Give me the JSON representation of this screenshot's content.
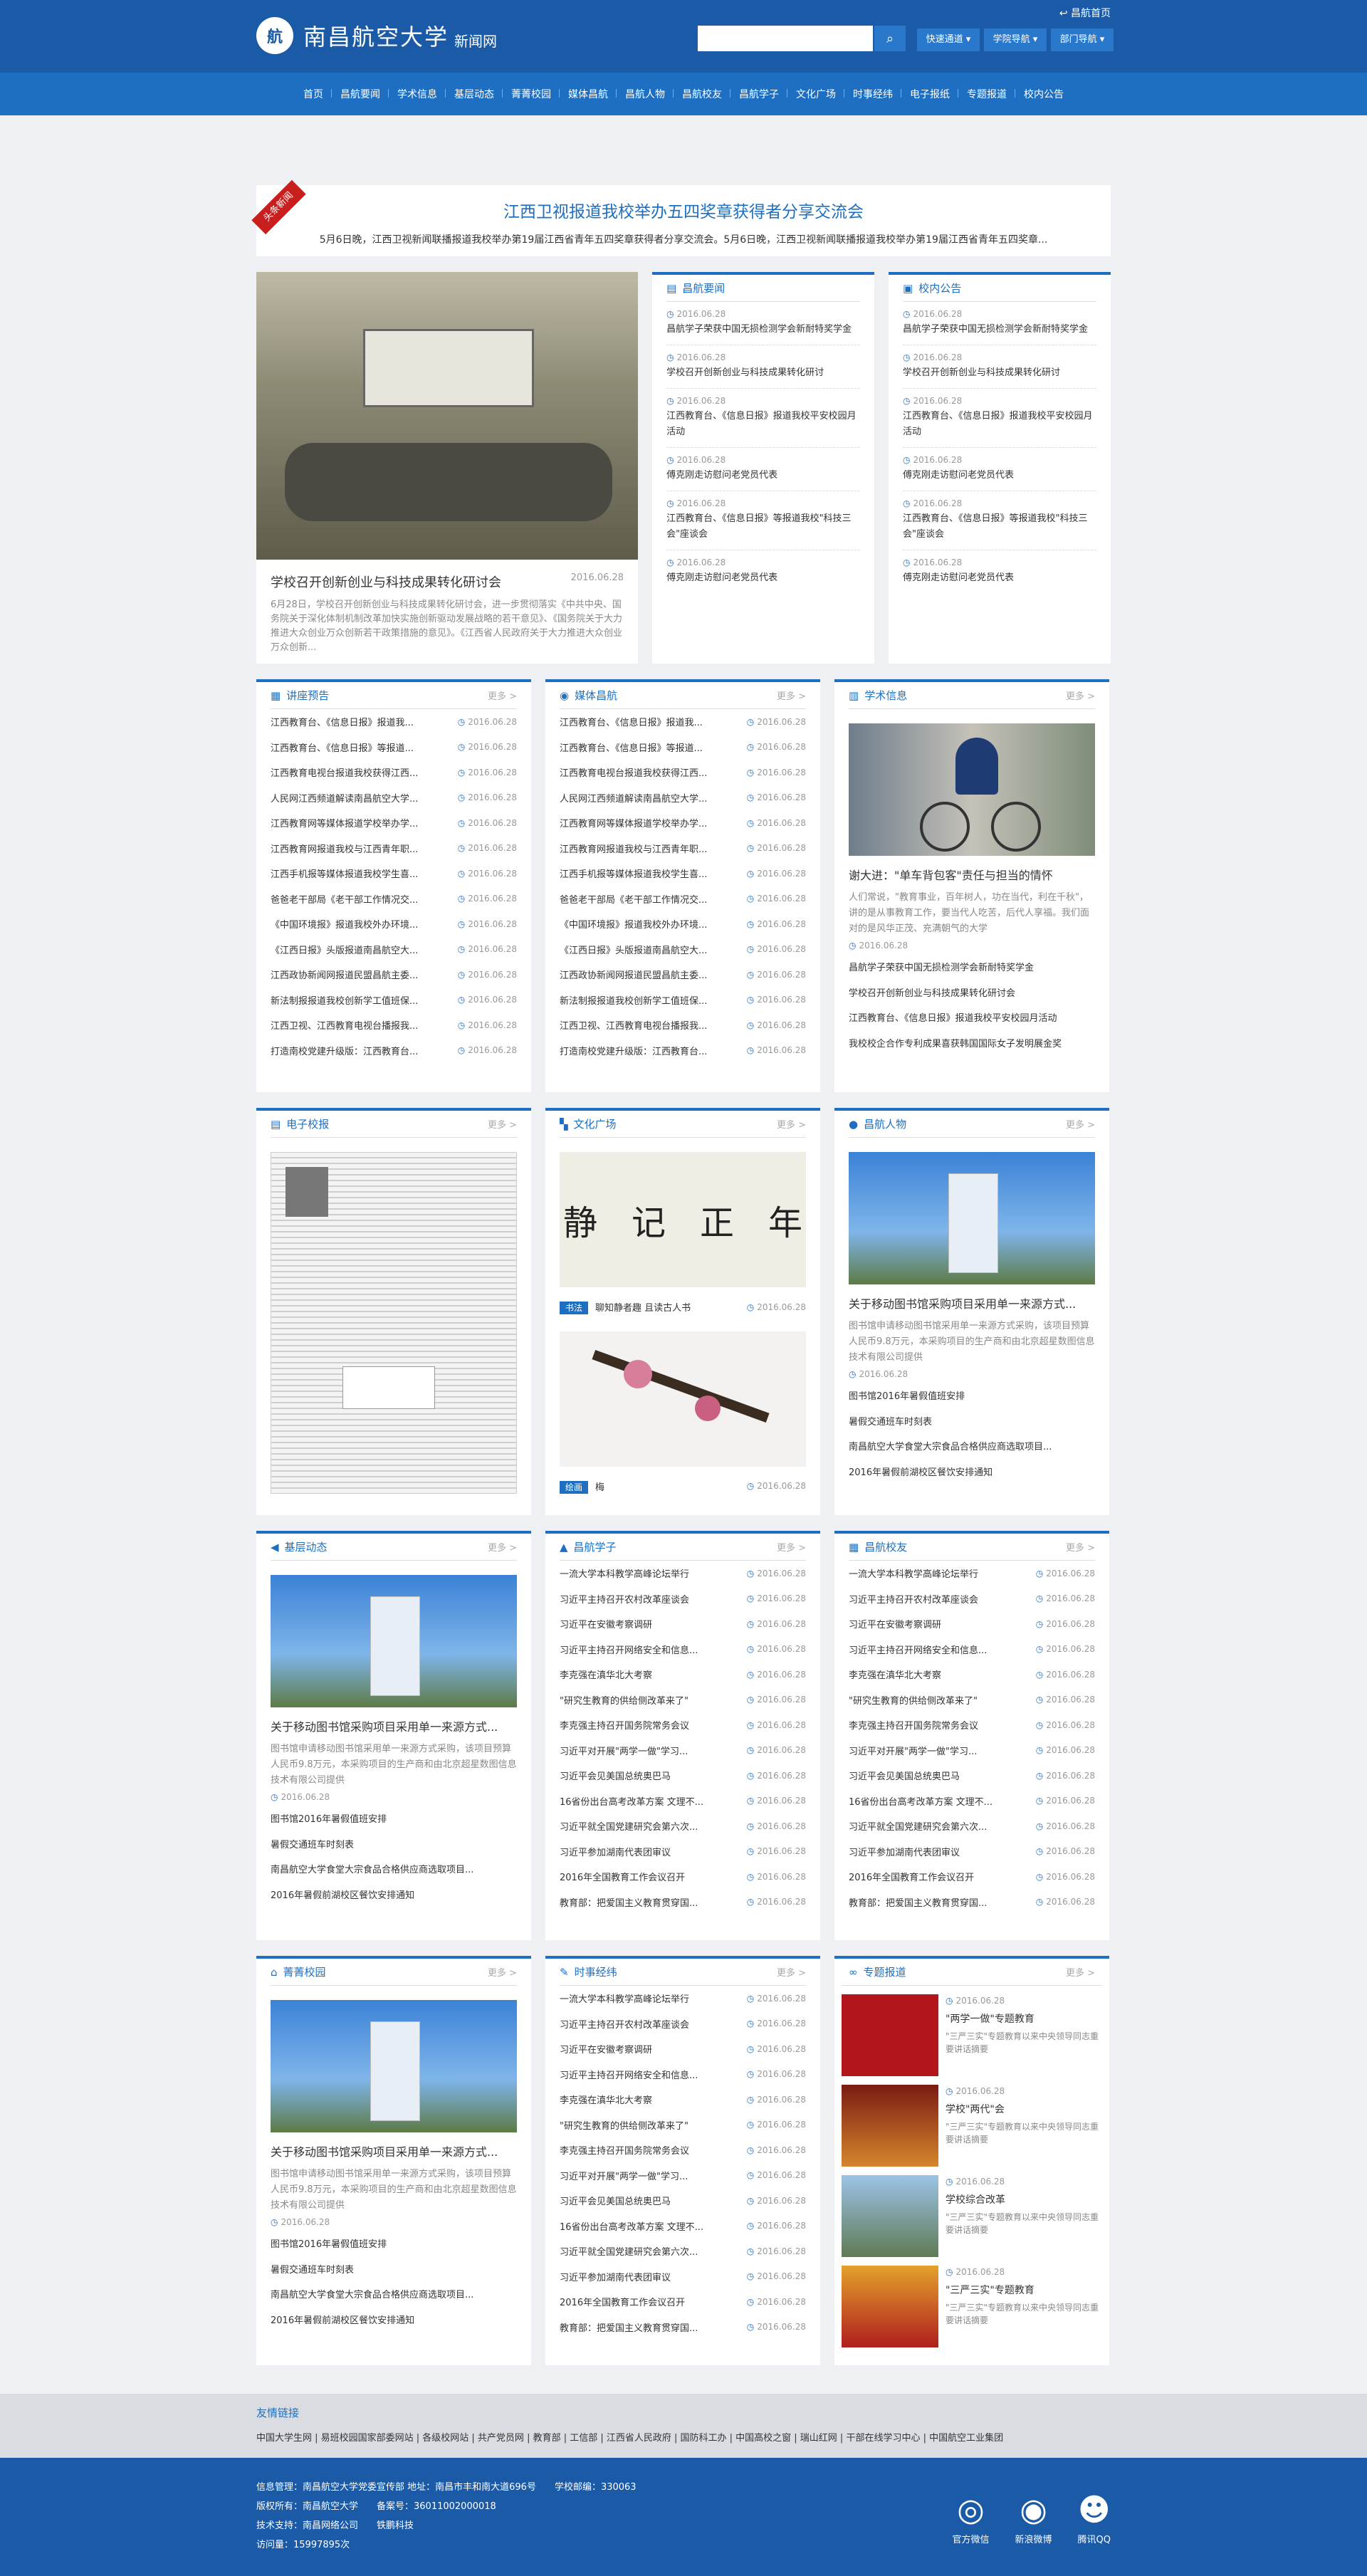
{
  "header": {
    "logo_text": "南昌航空大学",
    "logo_sub": "新闻网",
    "home_link": "昌航首页",
    "quick": [
      "快速通道",
      "学院导航",
      "部门导航"
    ]
  },
  "nav": [
    "首页",
    "昌航要闻",
    "学术信息",
    "基层动态",
    "菁菁校园",
    "媒体昌航",
    "昌航人物",
    "昌航校友",
    "昌航学子",
    "文化广场",
    "时事经纬",
    "电子报纸",
    "专题报道",
    "校内公告"
  ],
  "headline": {
    "tag": "头条新闻",
    "title": "江西卫视报道我校举办五四奖章获得者分享交流会",
    "summary": "5月6日晚，江西卫视新闻联播报道我校举办第19届江西省青年五四奖章获得者分享交流会。5月6日晚，江西卫视新闻联播报道我校举办第19届江西省青年五四奖章..."
  },
  "feature": {
    "title": "学校召开创新创业与科技成果转化研讨会",
    "date": "2016.06.28",
    "desc": "6月28日，学校召开创新创业与科技成果转化研讨会，进一步贯彻落实《中共中央、国务院关于深化体制机制改革加快实施创新驱动发展战略的若干意见》、《国务院关于大力推进大众创业万众创新若干政策措施的意见》。《江西省人民政府关于大力推进大众创业万众创新..."
  },
  "news": {
    "title": "昌航要闻",
    "items": [
      {
        "d": "2016.06.28",
        "t": "昌航学子荣获中国无损检测学会新耐特奖学金"
      },
      {
        "d": "2016.06.28",
        "t": "学校召开创新创业与科技成果转化研讨"
      },
      {
        "d": "2016.06.28",
        "t": "江西教育台、《信息日报》报道我校平安校园月活动"
      },
      {
        "d": "2016.06.28",
        "t": "傅克刚走访慰问老党员代表"
      },
      {
        "d": "2016.06.28",
        "t": "江西教育台、《信息日报》等报道我校\"科技三会\"座谈会"
      },
      {
        "d": "2016.06.28",
        "t": "傅克刚走访慰问老党员代表"
      }
    ]
  },
  "notice": {
    "title": "校内公告",
    "items": [
      {
        "d": "2016.06.28",
        "t": "昌航学子荣获中国无损检测学会新耐特奖学金"
      },
      {
        "d": "2016.06.28",
        "t": "学校召开创新创业与科技成果转化研讨"
      },
      {
        "d": "2016.06.28",
        "t": "江西教育台、《信息日报》报道我校平安校园月活动"
      },
      {
        "d": "2016.06.28",
        "t": "傅克刚走访慰问老党员代表"
      },
      {
        "d": "2016.06.28",
        "t": "江西教育台、《信息日报》等报道我校\"科技三会\"座谈会"
      },
      {
        "d": "2016.06.28",
        "t": "傅克刚走访慰问老党员代表"
      }
    ]
  },
  "more": "更多 >",
  "lecture": {
    "title": "讲座预告",
    "items": [
      "江西教育台、《信息日报》报道我...",
      "江西教育台、《信息日报》等报道...",
      "江西教育电视台报道我校获得江西...",
      "人民网江西频道解读南昌航空大学...",
      "江西教育网等媒体报道学校举办学...",
      "江西教育网报道我校与江西青年职...",
      "江西手机报等媒体报道我校学生喜...",
      "爸爸老干部局《老干部工作情况交...",
      "《中国环境报》报道我校外办环境...",
      "《江西日报》头版报道南昌航空大...",
      "江西政协新闻网报道民盟昌航主委...",
      "新法制报报道我校创新学工值班保...",
      "江西卫视、江西教育电视台播报我...",
      "打造南校党建升级版：江西教育台..."
    ]
  },
  "media": {
    "title": "媒体昌航",
    "items": [
      "江西教育台、《信息日报》报道我...",
      "江西教育台、《信息日报》等报道...",
      "江西教育电视台报道我校获得江西...",
      "人民网江西频道解读南昌航空大学...",
      "江西教育网等媒体报道学校举办学...",
      "江西教育网报道我校与江西青年职...",
      "江西手机报等媒体报道我校学生喜...",
      "爸爸老干部局《老干部工作情况交...",
      "《中国环境报》报道我校外办环境...",
      "《江西日报》头版报道南昌航空大...",
      "江西政协新闻网报道民盟昌航主委...",
      "新法制报报道我校创新学工值班保...",
      "江西卫视、江西教育电视台播报我...",
      "打造南校党建升级版：江西教育台..."
    ]
  },
  "academic": {
    "title": "学术信息",
    "cap": "谢大进：\"单车背包客\"责任与担当的情怀",
    "desc": "人们常说，\"教育事业，百年树人，功在当代，利在千秋\"，讲的是从事教育工作，要当代人吃苦，后代人享福。我们面对的是风华正茂、充满朝气的大学",
    "date": "2016.06.28",
    "links": [
      "昌航学子荣获中国无损检测学会新耐特奖学金",
      "学校召开创新创业与科技成果转化研讨会",
      "江西教育台、《信息日报》报道我校平安校园月活动",
      "我校校企合作专利成果喜获韩国国际女子发明展金奖"
    ]
  },
  "epaper": {
    "title": "电子校报"
  },
  "culture": {
    "title": "文化广场",
    "i1tag": "书法",
    "i1": "聊知静者趣 且读古人书",
    "i2tag": "绘画",
    "i2": "梅",
    "date": "2016.06.28",
    "calli": "静　记　正　年"
  },
  "people": {
    "title": "昌航人物",
    "cap": "关于移动图书馆采购项目采用单一来源方式...",
    "desc": "图书馆申请移动图书馆采用单一来源方式采购，该项目预算人民币9.8万元，本采购项目的生产商和由北京超星数图信息技术有限公司提供",
    "date": "2016.06.28",
    "links": [
      "图书馆2016年暑假值班安排",
      "暑假交通班车时刻表",
      "南昌航空大学食堂大宗食品合格供应商选取项目...",
      "2016年暑假前湖校区餐饮安排通知"
    ]
  },
  "grass": {
    "title": "基层动态",
    "cap": "关于移动图书馆采购项目采用单一来源方式...",
    "desc": "图书馆申请移动图书馆采用单一来源方式采购，该项目预算人民币9.8万元，本采购项目的生产商和由北京超星数图信息技术有限公司提供",
    "date": "2016.06.28",
    "links": [
      "图书馆2016年暑假值班安排",
      "暑假交通班车时刻表",
      "南昌航空大学食堂大宗食品合格供应商选取项目...",
      "2016年暑假前湖校区餐饮安排通知"
    ]
  },
  "students": {
    "title": "昌航学子",
    "items": [
      "一流大学本科教学高峰论坛举行",
      "习近平主持召开农村改革座谈会",
      "习近平在安徽考察调研",
      "习近平主持召开网络安全和信息...",
      "李克强在滇华北大考察",
      "\"研究生教育的供给侧改革来了\"",
      "李克强主持召开国务院常务会议",
      "习近平对开展\"两学一做\"学习...",
      "习近平会见美国总统奥巴马",
      "16省份出台高考改革方案 文理不...",
      "习近平就全国党建研究会第六次...",
      "习近平参加湖南代表团审议",
      "2016年全国教育工作会议召开",
      "教育部：把爱国主义教育贯穿国..."
    ]
  },
  "alumni": {
    "title": "昌航校友",
    "items": [
      "一流大学本科教学高峰论坛举行",
      "习近平主持召开农村改革座谈会",
      "习近平在安徽考察调研",
      "习近平主持召开网络安全和信息...",
      "李克强在滇华北大考察",
      "\"研究生教育的供给侧改革来了\"",
      "李克强主持召开国务院常务会议",
      "习近平对开展\"两学一做\"学习...",
      "习近平会见美国总统奥巴马",
      "16省份出台高考改革方案 文理不...",
      "习近平就全国党建研究会第六次...",
      "习近平参加湖南代表团审议",
      "2016年全国教育工作会议召开",
      "教育部：把爱国主义教育贯穿国..."
    ]
  },
  "campus": {
    "title": "菁菁校园",
    "cap": "关于移动图书馆采购项目采用单一来源方式...",
    "desc": "图书馆申请移动图书馆采用单一来源方式采购，该项目预算人民币9.8万元，本采购项目的生产商和由北京超星数图信息技术有限公司提供",
    "date": "2016.06.28",
    "links": [
      "图书馆2016年暑假值班安排",
      "暑假交通班车时刻表",
      "南昌航空大学食堂大宗食品合格供应商选取项目...",
      "2016年暑假前湖校区餐饮安排通知"
    ]
  },
  "current": {
    "title": "时事经纬",
    "items": [
      "一流大学本科教学高峰论坛举行",
      "习近平主持召开农村改革座谈会",
      "习近平在安徽考察调研",
      "习近平主持召开网络安全和信息...",
      "李克强在滇华北大考察",
      "\"研究生教育的供给侧改革来了\"",
      "李克强主持召开国务院常务会议",
      "习近平对开展\"两学一做\"学习...",
      "习近平会见美国总统奥巴马",
      "16省份出台高考改革方案 文理不...",
      "习近平就全国党建研究会第六次...",
      "习近平参加湖南代表团审议",
      "2016年全国教育工作会议召开",
      "教育部：把爱国主义教育贯穿国..."
    ]
  },
  "special": {
    "title": "专题报道",
    "items": [
      {
        "d": "2016.06.28",
        "t": "\"两学一做\"专题教育",
        "s": "\"三严三实\"专题教育以来中央领导同志重要讲话摘要"
      },
      {
        "d": "2016.06.28",
        "t": "学校\"两代\"会",
        "s": "\"三严三实\"专题教育以来中央领导同志重要讲话摘要"
      },
      {
        "d": "2016.06.28",
        "t": "学校综合改革",
        "s": "\"三严三实\"专题教育以来中央领导同志重要讲话摘要"
      },
      {
        "d": "2016.06.28",
        "t": "\"三严三实\"专题教育",
        "s": "\"三严三实\"专题教育以来中央领导同志重要讲话摘要"
      }
    ]
  },
  "date": "2016.06.28",
  "links": {
    "title": "友情链接",
    "text": "中国大学生网 | 易班校园国家部委网站 | 各级校网站 | 共产党员网 | 教育部 | 工信部 | 江西省人民政府 | 国防科工办 | 中国高校之窗 | 瑞山红网 | 干部在线学习中心 | 中国航空工业集团"
  },
  "footer": {
    "l1": "信息管理：南昌航空大学党委宣传部 地址：南昌市丰和南大道696号　　学校邮编：330063",
    "l2": "版权所有：南昌航空大学　　备案号：36011002000018",
    "l3": "技术支持：南昌网络公司　　铁鹏科技",
    "l4": "访问量：15997895次",
    "s1": "官方微信",
    "s2": "新浪微博",
    "s3": "腾讯QQ"
  }
}
